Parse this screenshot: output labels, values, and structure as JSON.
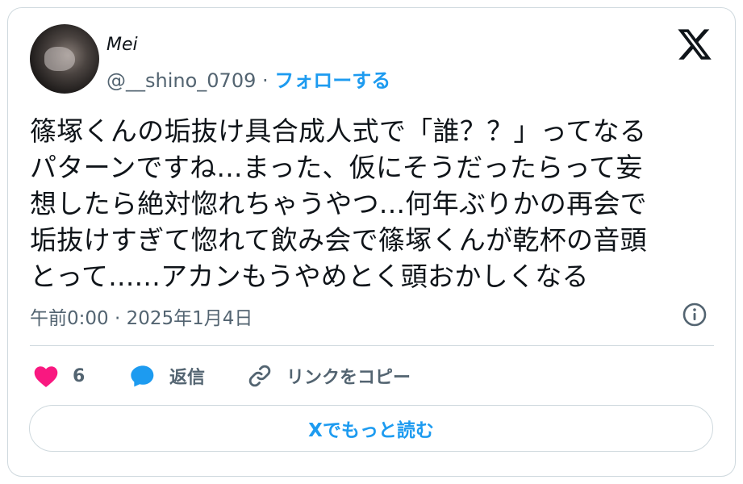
{
  "author": {
    "display_name": "Mei",
    "handle": "@__shino_0709",
    "separator": " · ",
    "follow_label": "フォローする"
  },
  "tweet": {
    "text": "篠塚くんの垢抜け具合成人式で「誰？？」ってなる\nパターンですね...まった、仮にそうだったらって妄\n想したら絶対惚れちゃうやつ...何年ぶりかの再会で\n垢抜けすぎて惚れて飲み会で篠塚くんが乾杯の音頭\nとって......アカンもうやめとく頭おかしくなる",
    "timestamp": "午前0:00 · 2025年1月4日"
  },
  "actions": {
    "like_count": "6",
    "reply_label": "返信",
    "copy_link_label": "リンクをコピー"
  },
  "read_more_label": "Xでもっと読む",
  "icons": [
    "x-logo-icon",
    "info-icon",
    "heart-icon",
    "speech-bubble-icon",
    "link-icon"
  ],
  "colors": {
    "accent": "#1d9bf0",
    "like": "#f91880",
    "text": "#0f1419",
    "secondary": "#536471",
    "border": "#cfd9de"
  }
}
